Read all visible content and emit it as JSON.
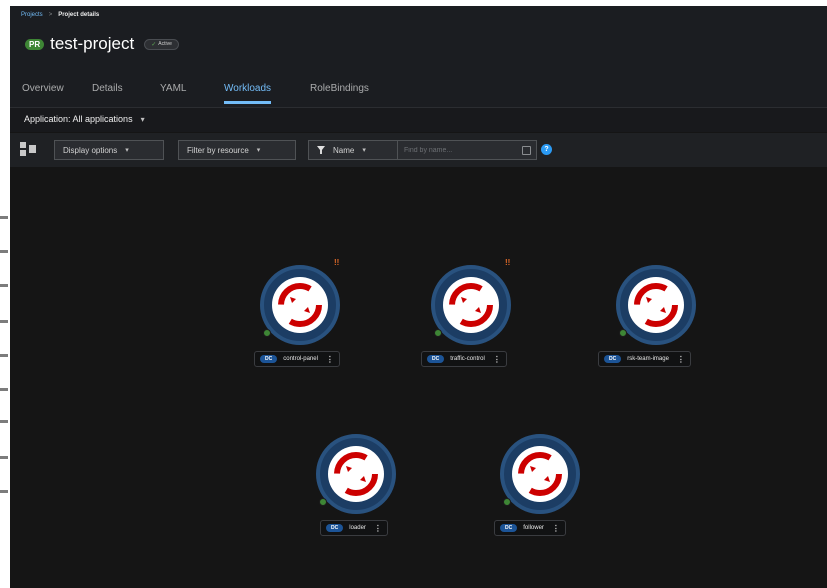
{
  "breadcrumb": {
    "parent": "Projects",
    "separator": ">",
    "current": "Project details"
  },
  "project": {
    "badge": "PR",
    "name": "test-project",
    "status": "Active",
    "status_icon": "check-icon"
  },
  "tabs": [
    "Overview",
    "Details",
    "YAML",
    "Workloads",
    "RoleBindings"
  ],
  "active_tab": "Workloads",
  "application_selector": {
    "label": "Application: All applications"
  },
  "toolbar": {
    "display_options": "Display options",
    "filter_by_resource": "Filter by resource",
    "filter_type": "Name",
    "search_placeholder": "Find by name...",
    "help": "?"
  },
  "nodes": [
    {
      "kind": "DC",
      "name": "control-panel",
      "alert": "!!",
      "pod_status": "running"
    },
    {
      "kind": "DC",
      "name": "traffic-control",
      "alert": "!!",
      "pod_status": "running"
    },
    {
      "kind": "DC",
      "name": "rsk-team-image",
      "alert": "",
      "pod_status": "running"
    },
    {
      "kind": "DC",
      "name": "loader",
      "alert": "",
      "pod_status": "running"
    },
    {
      "kind": "DC",
      "name": "follower",
      "alert": "",
      "pod_status": "running"
    }
  ],
  "colors": {
    "accent": "#73bcf7",
    "node_ring": "#1c3d64",
    "node_icon": "#cc0000",
    "badge_dc": "#1c5497",
    "pod_running": "#3e8635",
    "alert": "#e06a28"
  }
}
